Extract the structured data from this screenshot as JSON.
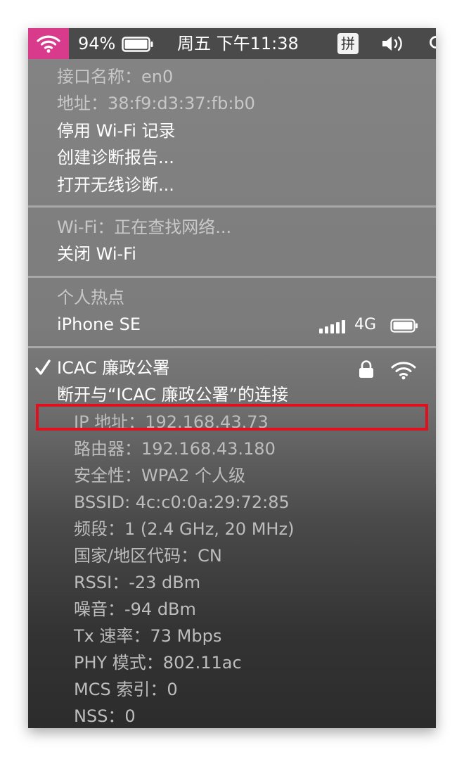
{
  "menubar": {
    "battery_percent": "94%",
    "clock": "周五 下午11:38",
    "input_method": "拼",
    "icons": [
      "wifi-icon",
      "battery-icon",
      "volume-icon",
      "search-icon"
    ],
    "wifi_active_color": "#d83a8c"
  },
  "interface": {
    "name": "接口名称：en0",
    "address": "地址：38:f9:d3:37:fb:b0",
    "disable_logging": "停用 Wi-Fi 记录",
    "create_report": "创建诊断报告...",
    "open_diagnostics": "打开无线诊断..."
  },
  "wifi_status": {
    "status": "Wi-Fi：正在查找网络...",
    "turn_off": "关闭 Wi-Fi"
  },
  "hotspot": {
    "header": "个人热点",
    "device_name": "iPhone SE",
    "network_type": "4G"
  },
  "network": {
    "name": "ICAC 廉政公署",
    "disconnect": "断开与“ICAC 廉政公署”的连接",
    "details": [
      "IP 地址：192.168.43.73",
      "路由器：192.168.43.180",
      "安全性：WPA2 个人级",
      "BSSID: 4c:c0:0a:29:72:85",
      "频段：1 (2.4 GHz, 20 MHz)",
      "国家/地区代码：CN",
      "RSSI：-23 dBm",
      "噪音：-94 dBm",
      "Tx 速率：73 Mbps",
      "PHY 模式：802.11ac",
      "MCS 索引：0",
      "NSS：0"
    ]
  },
  "colors": {
    "highlight_border": "#e0101f"
  }
}
